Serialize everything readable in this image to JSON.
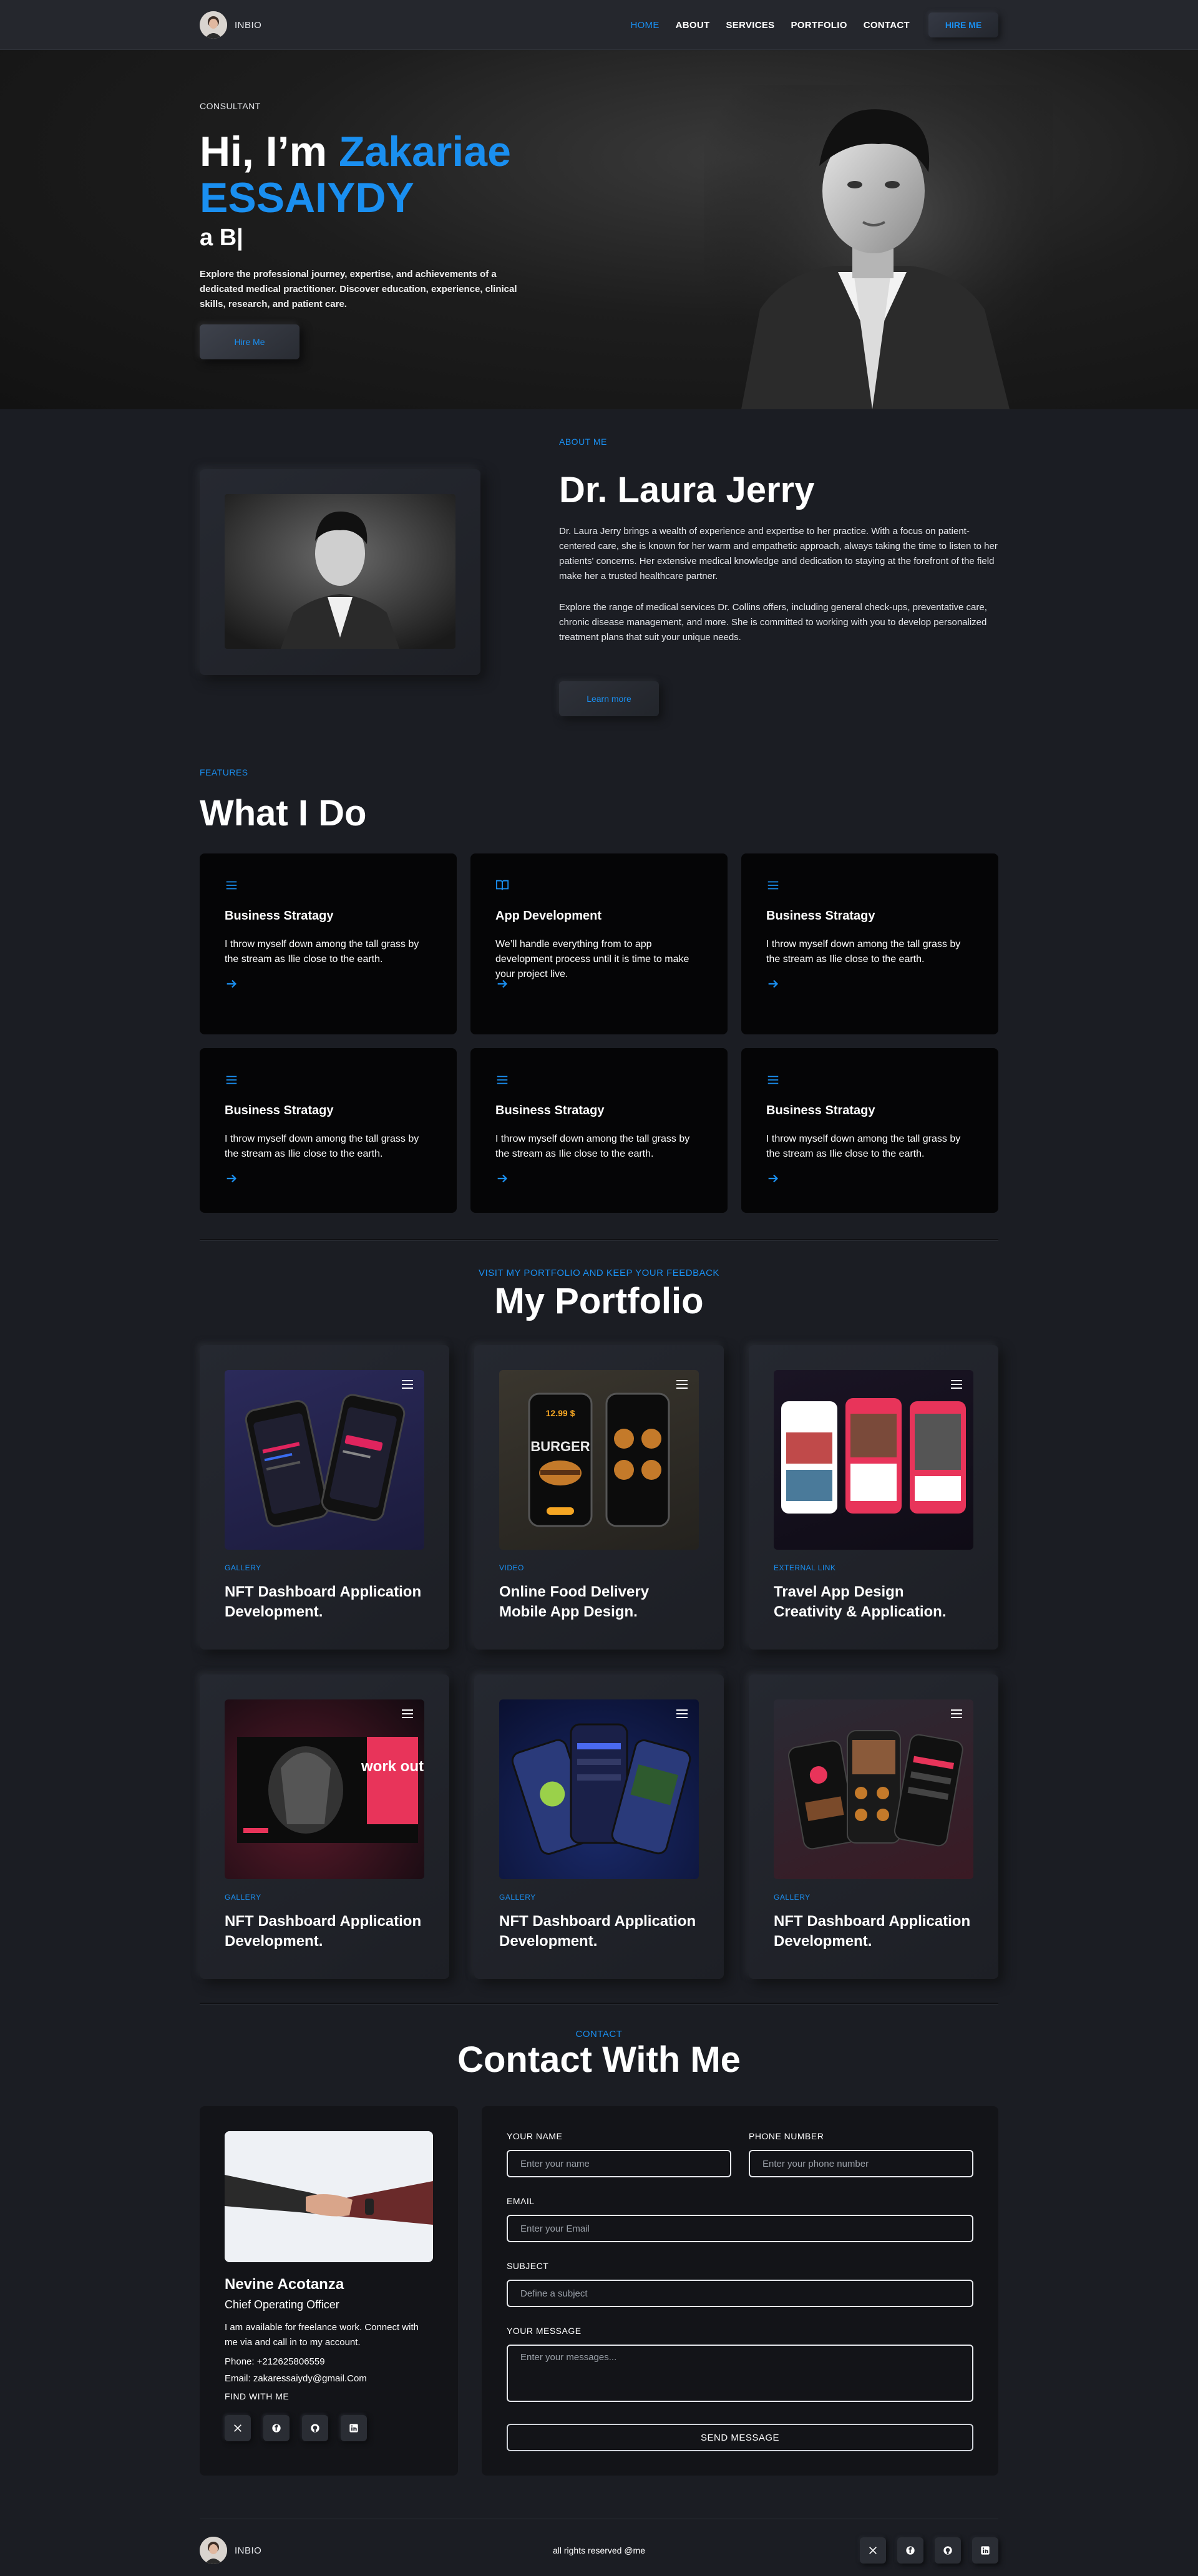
{
  "nav": {
    "brand": "INBIO",
    "links": [
      "HOME",
      "ABOUT",
      "SERVICES",
      "PORTFOLIO",
      "CONTACT"
    ],
    "active": "HOME",
    "hire_label": "HIRE ME"
  },
  "hero": {
    "subtitle": "CONSULTANT",
    "greeting": "Hi, I’m ",
    "name": "Zakariae ESSAIYDY",
    "role": "a B|",
    "description": "Explore the professional journey, expertise, and achievements of a dedicated medical practitioner. Discover education, experience, clinical skills, research, and patient care.",
    "button": "Hire Me"
  },
  "about": {
    "kicker": "ABOUT ME",
    "name": "Dr. Laura Jerry",
    "p1": "Dr. Laura Jerry brings a wealth of experience and expertise to her practice. With a focus on patient-centered care, she is known for her warm and empathetic approach, always taking the time to listen to her patients' concerns. Her extensive medical knowledge and dedication to staying at the forefront of the field make her a trusted healthcare partner.",
    "p2": "Explore the range of medical services Dr. Collins offers, including general check-ups, preventative care, chronic disease management, and more. She is committed to working with you to develop personalized treatment plans that suit your unique needs.",
    "button": "Learn more"
  },
  "features": {
    "kicker": "FEATURES",
    "title": "What I Do",
    "cards": [
      {
        "icon": "menu-icon",
        "title": "Business Stratagy",
        "text": "I throw myself down among the tall grass by the stream as Ilie close to the earth."
      },
      {
        "icon": "book-icon",
        "title": "App Development",
        "text": "We’ll handle everything from to app development process until it is time to make your project live."
      },
      {
        "icon": "menu-icon",
        "title": "Business Stratagy",
        "text": "I throw myself down among the tall grass by the stream as Ilie close to the earth."
      },
      {
        "icon": "menu-icon",
        "title": "Business Stratagy",
        "text": "I throw myself down among the tall grass by the stream as Ilie close to the earth."
      },
      {
        "icon": "menu-icon",
        "title": "Business Stratagy",
        "text": "I throw myself down among the tall grass by the stream as Ilie close to the earth."
      },
      {
        "icon": "menu-icon",
        "title": "Business Stratagy",
        "text": "I throw myself down among the tall grass by the stream as Ilie close to the earth."
      }
    ]
  },
  "portfolio": {
    "kicker": "VISIT MY PORTFOLIO AND KEEP YOUR FEEDBACK",
    "title": "My Portfolio",
    "items": [
      {
        "category": "GALLERY",
        "title": "NFT Dashboard Application Development."
      },
      {
        "category": "VIDEO",
        "title": "Online Food Delivery Mobile App Design."
      },
      {
        "category": "EXTERNAL LINK",
        "title": "Travel App Design Creativity & Application."
      },
      {
        "category": "GALLERY",
        "title": "NFT Dashboard Application Development."
      },
      {
        "category": "GALLERY",
        "title": "NFT Dashboard Application Development."
      },
      {
        "category": "GALLERY",
        "title": "NFT Dashboard Application Development."
      }
    ],
    "burger_price": "12.99 $",
    "burger_word": "BURGER",
    "workout_word": "work out"
  },
  "contact": {
    "kicker": "CONTACT",
    "title": "Contact With Me",
    "person": {
      "name": "Nevine Acotanza",
      "role": "Chief Operating Officer",
      "text": "I am available for freelance work. Connect with me via and call in to my account.",
      "phone": "Phone: +212625806559",
      "email": "Email: zakaressaiydy@gmail.Com",
      "find": "FIND WITH ME"
    },
    "form": {
      "name_label": "YOUR NAME",
      "name_placeholder": "Enter your name",
      "phone_label": "PHONE NUMBER",
      "phone_placeholder": "Enter your phone number",
      "email_label": "EMAIL",
      "email_placeholder": "Enter your Email",
      "subject_label": "SUBJECT",
      "subject_placeholder": "Define a subject",
      "message_label": "YOUR MESSAGE",
      "message_placeholder": "Enter your messages...",
      "send": "SEND MESSAGE"
    }
  },
  "footer": {
    "brand": "INBIO",
    "copyright": "all rights reserved @me"
  },
  "colors": {
    "accent": "#1a8ff0",
    "background": "#1b1d23",
    "card": "#050506"
  },
  "social_icons": [
    "x-icon",
    "facebook-icon",
    "github-icon",
    "linkedin-icon"
  ]
}
